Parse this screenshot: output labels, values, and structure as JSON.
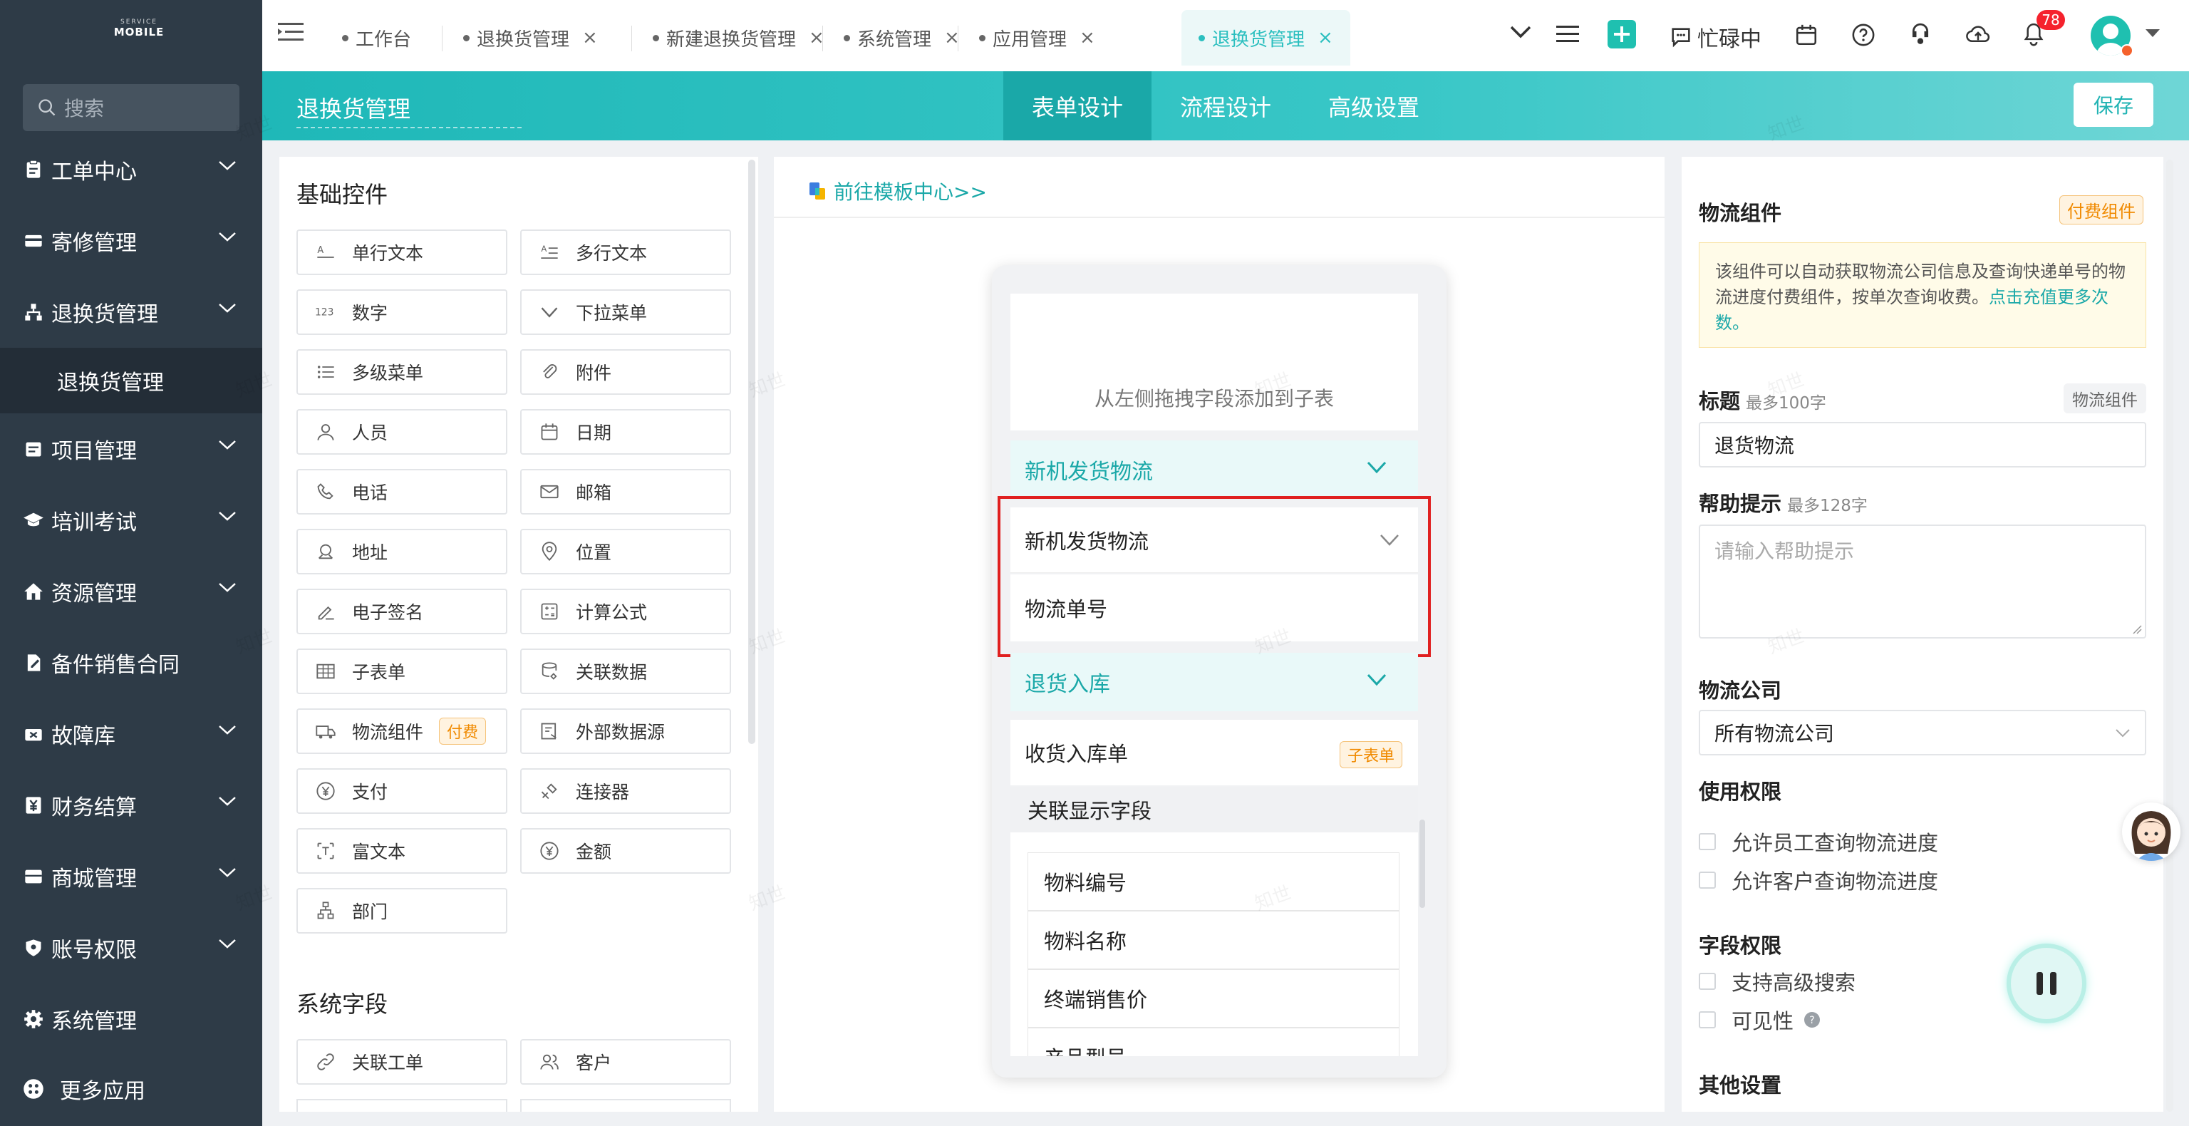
{
  "sidebar": {
    "logo_top": "SERVICE",
    "logo_bottom": "MOBILE",
    "search_placeholder": "搜索",
    "items": [
      {
        "label": "工单中心",
        "icon": "clipboard-icon",
        "expandable": true
      },
      {
        "label": "寄修管理",
        "icon": "card-icon",
        "expandable": true
      },
      {
        "label": "退换货管理",
        "icon": "sitemap-icon",
        "expandable": true
      },
      {
        "label": "项目管理",
        "icon": "project-icon",
        "expandable": true
      },
      {
        "label": "培训考试",
        "icon": "graduation-cap-icon",
        "expandable": true
      },
      {
        "label": "资源管理",
        "icon": "home-icon",
        "expandable": true
      },
      {
        "label": "备件销售合同",
        "icon": "contract-icon",
        "expandable": false
      },
      {
        "label": "故障库",
        "icon": "wrench-icon",
        "expandable": true
      },
      {
        "label": "财务结算",
        "icon": "yen-icon",
        "expandable": true
      },
      {
        "label": "商城管理",
        "icon": "shop-icon",
        "expandable": true
      },
      {
        "label": "账号权限",
        "icon": "shield-icon",
        "expandable": true
      },
      {
        "label": "系统管理",
        "icon": "gear-icon",
        "expandable": false
      }
    ],
    "sub_item": "退换货管理",
    "more_apps": "更多应用"
  },
  "tabs": [
    {
      "label": "工作台",
      "closable": false
    },
    {
      "label": "退换货管理",
      "closable": true
    },
    {
      "label": "新建退换货管理",
      "closable": true
    },
    {
      "label": "系统管理",
      "closable": true
    },
    {
      "label": "应用管理",
      "closable": true
    },
    {
      "label": "退换货管理",
      "closable": true,
      "active": true
    }
  ],
  "topbar": {
    "status": "忙碌中",
    "notification_count": "78"
  },
  "header": {
    "title": "退换货管理",
    "tabs": [
      "表单设计",
      "流程设计",
      "高级设置"
    ],
    "save": "保存"
  },
  "left_panel": {
    "basic_title": "基础控件",
    "controls": [
      {
        "label": "单行文本",
        "icon": "single-line-text-icon"
      },
      {
        "label": "多行文本",
        "icon": "multi-line-text-icon"
      },
      {
        "label": "数字",
        "icon": "number-icon"
      },
      {
        "label": "下拉菜单",
        "icon": "dropdown-icon"
      },
      {
        "label": "多级菜单",
        "icon": "list-icon"
      },
      {
        "label": "附件",
        "icon": "paperclip-icon"
      },
      {
        "label": "人员",
        "icon": "person-icon"
      },
      {
        "label": "日期",
        "icon": "calendar-icon"
      },
      {
        "label": "电话",
        "icon": "phone-icon"
      },
      {
        "label": "邮箱",
        "icon": "mail-icon"
      },
      {
        "label": "地址",
        "icon": "map-icon"
      },
      {
        "label": "位置",
        "icon": "location-pin-icon"
      },
      {
        "label": "电子签名",
        "icon": "signature-icon"
      },
      {
        "label": "计算公式",
        "icon": "calculator-icon"
      },
      {
        "label": "子表单",
        "icon": "table-icon"
      },
      {
        "label": "关联数据",
        "icon": "link-data-icon"
      },
      {
        "label": "物流组件",
        "icon": "truck-icon",
        "badge": "付费"
      },
      {
        "label": "外部数据源",
        "icon": "external-data-icon"
      },
      {
        "label": "支付",
        "icon": "yen-circle-icon"
      },
      {
        "label": "连接器",
        "icon": "connector-icon"
      },
      {
        "label": "富文本",
        "icon": "rich-text-icon"
      },
      {
        "label": "金额",
        "icon": "amount-icon"
      },
      {
        "label": "部门",
        "icon": "org-icon"
      }
    ],
    "system_title": "系统字段",
    "system_controls": [
      {
        "label": "关联工单",
        "icon": "link-icon"
      },
      {
        "label": "客户",
        "icon": "customer-icon"
      }
    ]
  },
  "middle": {
    "template_link": "前往模板中心>>",
    "drag_hint": "从左侧拖拽字段添加到子表",
    "group1": "新机发货物流",
    "selected_row1": "新机发货物流",
    "selected_row2": "物流单号",
    "group2": "退货入库",
    "receipt_row": "收货入库单",
    "receipt_badge": "子表单",
    "assoc_title": "关联显示字段",
    "assoc_fields": [
      "物料编号",
      "物料名称",
      "终端销售价",
      "产品型号"
    ],
    "highlight_color": "#e02020"
  },
  "right": {
    "title": "物流组件",
    "paid_badge": "付费组件",
    "info_text": "该组件可以自动获取物流公司信息及查询快递单号的物流进度付费组件，按单次查询收费。",
    "info_link": "点击充值更多次数。",
    "title_label": "标题",
    "title_hint": "最多100字",
    "title_tag": "物流组件",
    "title_value": "退货物流",
    "help_label": "帮助提示",
    "help_hint": "最多128字",
    "help_placeholder": "请输入帮助提示",
    "company_label": "物流公司",
    "company_value": "所有物流公司",
    "usage_label": "使用权限",
    "usage_opts": [
      "允许员工查询物流进度",
      "允许客户查询物流进度"
    ],
    "field_label": "字段权限",
    "field_opts": [
      "支持高级搜索",
      "可见性"
    ],
    "other_label": "其他设置"
  },
  "colors": {
    "accent": "#1fb8b8",
    "sidebar": "#2e3b47",
    "badge_red": "#f5222d"
  },
  "watermark": "知世"
}
